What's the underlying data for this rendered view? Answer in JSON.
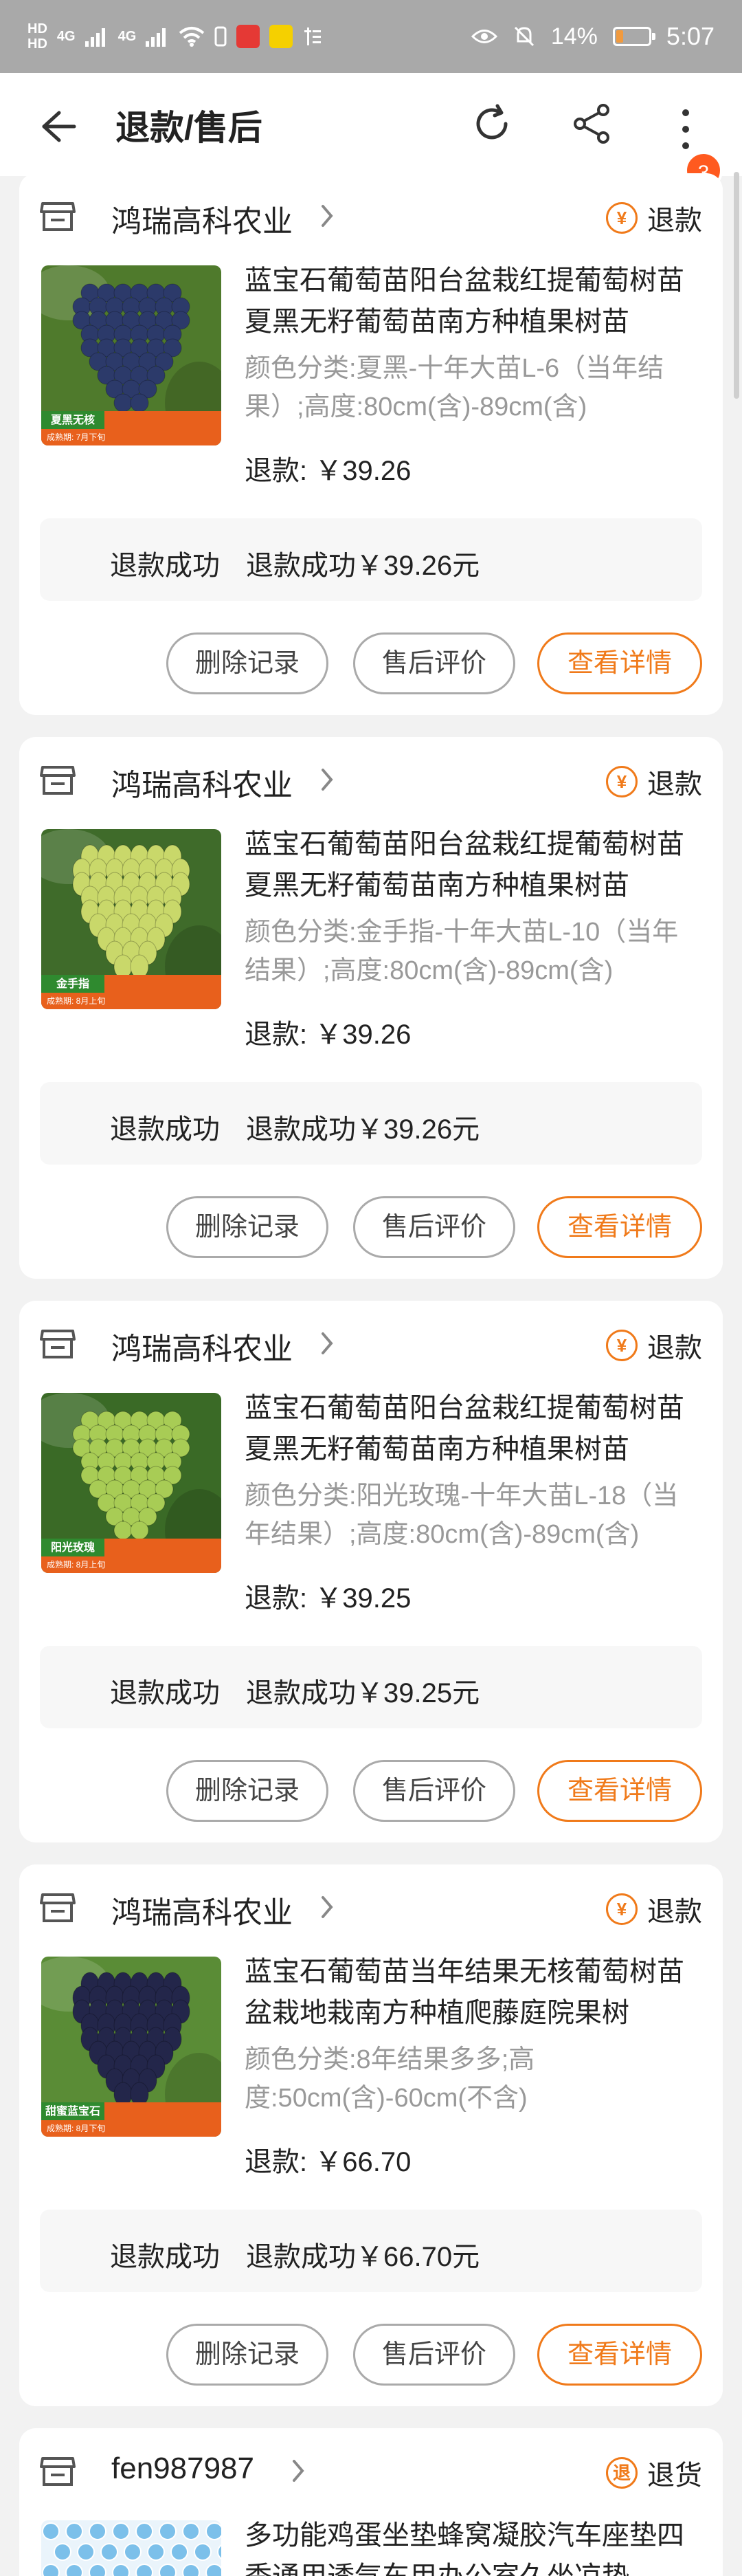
{
  "status_bar": {
    "time": "5:07",
    "battery_percent": "14%",
    "net_label_1": "HD",
    "net_label_2": "HD",
    "signal_1": "4G",
    "signal_2": "4G",
    "icon_colors": {
      "app1": "#e53935",
      "app2": "#f5d000"
    }
  },
  "nav": {
    "title": "退款/售后",
    "badge_count": "3"
  },
  "orders": [
    {
      "shop": "鸿瑞高科农业",
      "status_icon": "¥",
      "status": "退款",
      "title": "蓝宝石葡萄苗阳台盆栽红提葡萄树苗夏黑无籽葡萄苗南方种植果树苗",
      "spec": "颜色分类:夏黑-十年大苗L-6（当年结果）;高度:80cm(含)-89cm(含)",
      "refund": "退款: ￥39.26",
      "result_label": "退款成功",
      "result_value": "退款成功￥39.26元",
      "buttons": [
        "删除记录",
        "售后评价",
        "查看详情"
      ],
      "image": {
        "variety_label": "夏黑无核",
        "caption": "成熟期: 7月下旬",
        "grape_color": "#2c3a6a",
        "leaf_color": "#4f7a2c"
      }
    },
    {
      "shop": "鸿瑞高科农业",
      "status_icon": "¥",
      "status": "退款",
      "title": "蓝宝石葡萄苗阳台盆栽红提葡萄树苗夏黑无籽葡萄苗南方种植果树苗",
      "spec": "颜色分类:金手指-十年大苗L-10（当年结果）;高度:80cm(含)-89cm(含)",
      "refund": "退款: ￥39.26",
      "result_label": "退款成功",
      "result_value": "退款成功￥39.26元",
      "buttons": [
        "删除记录",
        "售后评价",
        "查看详情"
      ],
      "image": {
        "variety_label": "金手指",
        "caption": "成熟期: 8月上旬",
        "grape_color": "#c9d86a",
        "leaf_color": "#3f6b2a"
      }
    },
    {
      "shop": "鸿瑞高科农业",
      "status_icon": "¥",
      "status": "退款",
      "title": "蓝宝石葡萄苗阳台盆栽红提葡萄树苗夏黑无籽葡萄苗南方种植果树苗",
      "spec": "颜色分类:阳光玫瑰-十年大苗L-18（当年结果）;高度:80cm(含)-89cm(含)",
      "refund": "退款: ￥39.25",
      "result_label": "退款成功",
      "result_value": "退款成功￥39.25元",
      "buttons": [
        "删除记录",
        "售后评价",
        "查看详情"
      ],
      "image": {
        "variety_label": "阳光玫瑰",
        "caption": "成熟期: 8月上旬",
        "grape_color": "#a8cc55",
        "leaf_color": "#3a6a26"
      }
    },
    {
      "shop": "鸿瑞高科农业",
      "status_icon": "¥",
      "status": "退款",
      "title": "蓝宝石葡萄苗当年结果无核葡萄树苗盆栽地栽南方种植爬藤庭院果树",
      "spec": "颜色分类:8年结果多多;高度:50cm(含)-60cm(不含)",
      "refund": "退款: ￥66.70",
      "result_label": "退款成功",
      "result_value": "退款成功￥66.70元",
      "buttons": [
        "删除记录",
        "售后评价",
        "查看详情"
      ],
      "image": {
        "variety_label": "甜蜜蓝宝石",
        "caption": "成熟期: 8月下旬",
        "grape_color": "#23264a",
        "leaf_color": "#5a8c36"
      }
    },
    {
      "shop": "fen987987",
      "status_icon": "退",
      "status": "退货",
      "title": "多功能鸡蛋坐垫蜂窝凝胶汽车座垫四季通用透气车用办公室久坐凉垫",
      "image": {
        "variety_label": "",
        "caption": "",
        "grape_color": "#7cc0ea",
        "leaf_color": "#eaf4fb"
      }
    }
  ]
}
